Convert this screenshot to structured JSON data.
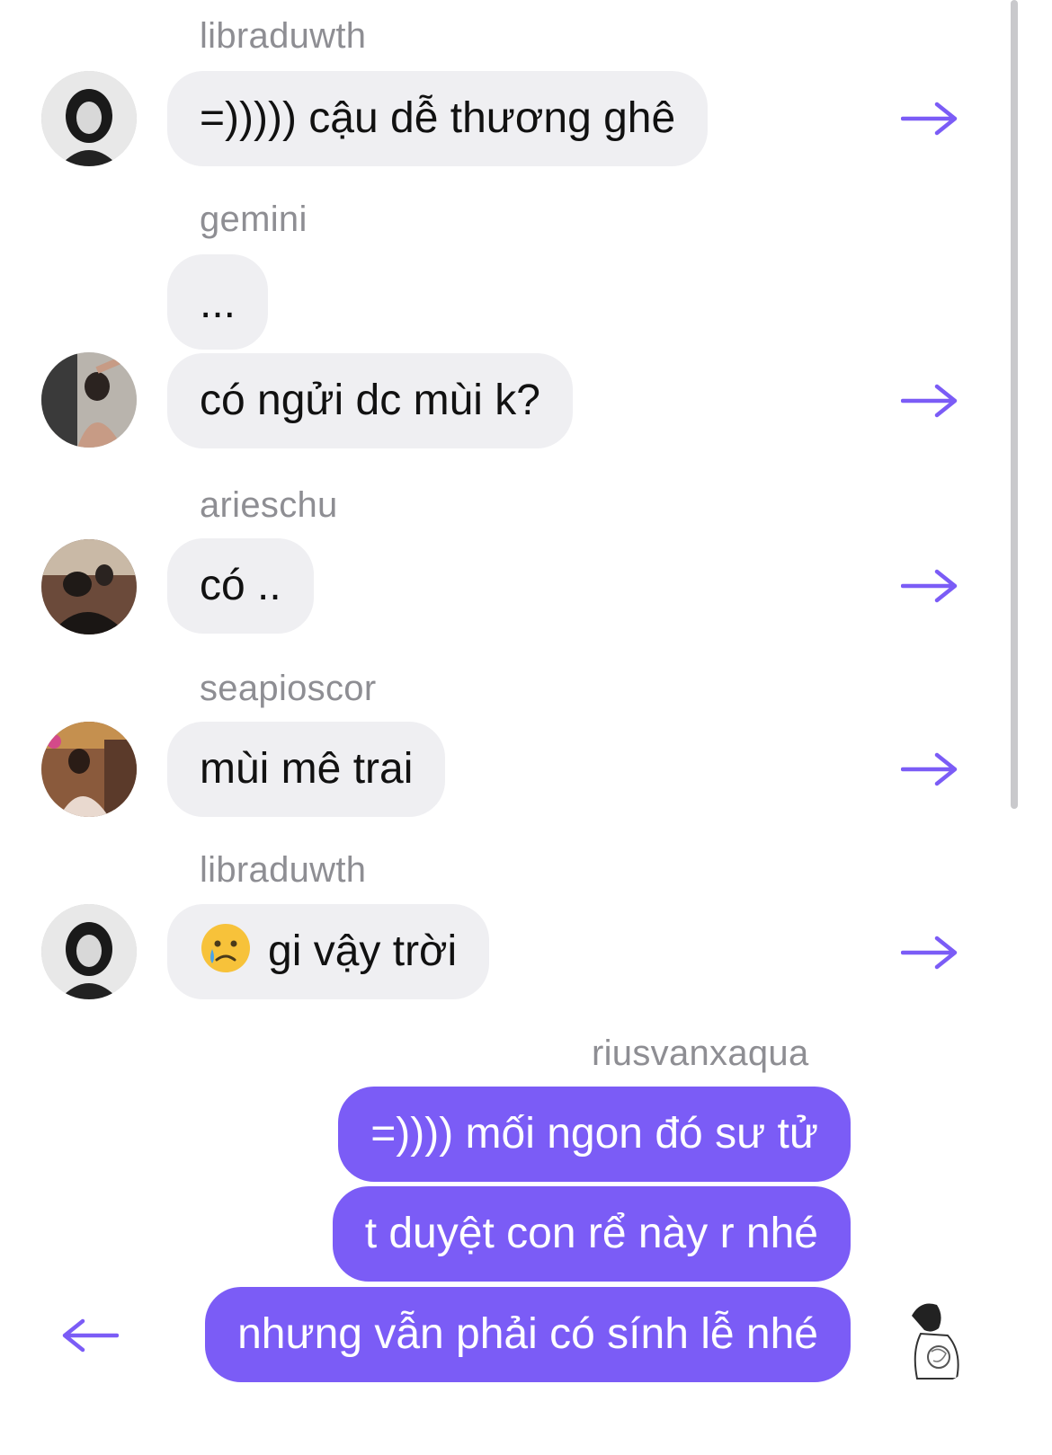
{
  "accent_color": "#7b5cf6",
  "incoming_bubble_color": "#efeff2",
  "messages": [
    {
      "sender": "libraduwth",
      "avatar_icon": "user-avatar-icon",
      "bubbles": [
        "=))))) cậu dễ thương ghê"
      ]
    },
    {
      "sender": "gemini",
      "avatar_icon": "user-avatar-icon",
      "bubbles": [
        "...",
        "có ngửi dc mùi k?"
      ]
    },
    {
      "sender": "arieschu",
      "avatar_icon": "user-avatar-icon",
      "bubbles": [
        "có .."
      ]
    },
    {
      "sender": "seapioscor",
      "avatar_icon": "user-avatar-icon",
      "bubbles": [
        "mùi mê trai"
      ]
    },
    {
      "sender": "libraduwth",
      "avatar_icon": "user-avatar-icon",
      "bubbles": [
        "gi vậy trời"
      ],
      "emoji": "crying-face-icon"
    },
    {
      "sender": "riusvanxaqua",
      "avatar_icon": "user-avatar-icon",
      "outgoing": true,
      "bubbles": [
        "=)))) mối ngon đó sư tử",
        "t duyệt con rể này r nhé",
        "nhưng vẫn phải có sính lễ nhé"
      ]
    }
  ],
  "icons": {
    "forward": "arrow-right-icon",
    "back": "arrow-left-icon"
  }
}
